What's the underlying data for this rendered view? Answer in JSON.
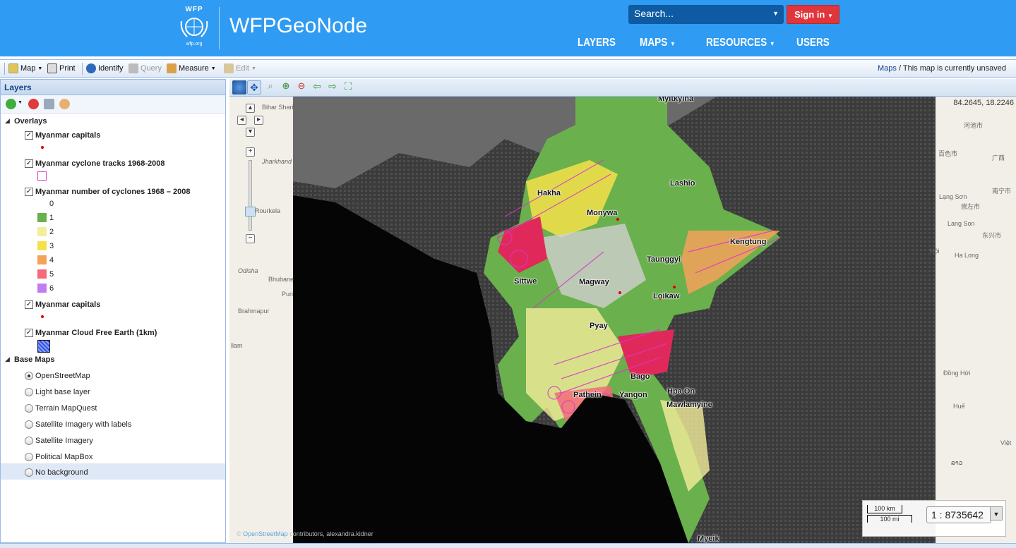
{
  "header": {
    "logo_top": "WFP",
    "logo_bottom": "wfp.org",
    "brand": "WFPGeoNode",
    "search_placeholder": "Search...",
    "signin_label": "Sign in",
    "nav": [
      "LAYERS",
      "MAPS",
      "RESOURCES",
      "USERS"
    ]
  },
  "toolbar": {
    "map": "Map",
    "print": "Print",
    "identify": "Identify",
    "query": "Query",
    "measure": "Measure",
    "edit": "Edit",
    "breadcrumb_link": "Maps",
    "breadcrumb_text": "/ This map is currently unsaved"
  },
  "layers_panel": {
    "title": "Layers",
    "overlays_label": "Overlays",
    "overlays": [
      {
        "label": "Myanmar capitals",
        "checked": true
      },
      {
        "label": "Myanmar cyclone tracks 1968-2008",
        "checked": true
      },
      {
        "label": "Myanmar number of cyclones 1968 – 2008",
        "checked": true
      },
      {
        "label": "Myanmar capitals",
        "checked": true
      },
      {
        "label": "Myanmar Cloud Free Earth (1km)",
        "checked": true
      }
    ],
    "cyclone_legend": [
      {
        "label": "0",
        "color": ""
      },
      {
        "label": "1",
        "color": "#6ab04c"
      },
      {
        "label": "2",
        "color": "#f4ee9a"
      },
      {
        "label": "3",
        "color": "#f5e24a"
      },
      {
        "label": "4",
        "color": "#f5a25a"
      },
      {
        "label": "5",
        "color": "#f56a7a"
      },
      {
        "label": "6",
        "color": "#c07cf0"
      }
    ],
    "base_maps_label": "Base Maps",
    "base_maps": [
      {
        "label": "OpenStreetMap",
        "selected": true
      },
      {
        "label": "Light base layer",
        "selected": false
      },
      {
        "label": "Terrain MapQuest",
        "selected": false
      },
      {
        "label": "Satellite Imagery with labels",
        "selected": false
      },
      {
        "label": "Satellite Imagery",
        "selected": false
      },
      {
        "label": "Political MapBox",
        "selected": false
      },
      {
        "label": "No background",
        "selected": false
      }
    ]
  },
  "map": {
    "coords": "84.2645, 18.2246",
    "city_labels": [
      "Myitkyina",
      "Hakha",
      "Lashio",
      "Monywa",
      "Kengtung",
      "Taunggyi",
      "Sittwe",
      "Magway",
      "Loikaw",
      "Pyay",
      "Bago",
      "Pathein",
      "Yangon",
      "Hpa On",
      "Mawlamyine",
      "Myeik"
    ],
    "osm_labels_left": [
      "Bihar Sharif",
      "Jharkhand",
      "Rourkela",
      "Odisha",
      "Bhubane",
      "Puri",
      "Brahmapur",
      "llam"
    ],
    "osm_labels_right": [
      "河池市",
      "百色市",
      "广西",
      "南宁市",
      "Lạng Sơn",
      "崇左市",
      "Lang Son",
      "东兴市",
      "Hội",
      "Ha Long",
      "Đồng Hới",
      "Huế",
      "Việt",
      "ລາວ"
    ],
    "scale_km": "100 km",
    "scale_mi": "100 mi",
    "scale_value": "1 : 8735642",
    "attribution_prefix": "©",
    "attribution_link": "OpenStreetMap",
    "attribution_suffix": "contributors, alexandra.kidner"
  },
  "colors": {
    "header_blue": "#2f9bf2",
    "signin_red": "#e0353a",
    "search_navy": "#0e5ba3"
  }
}
